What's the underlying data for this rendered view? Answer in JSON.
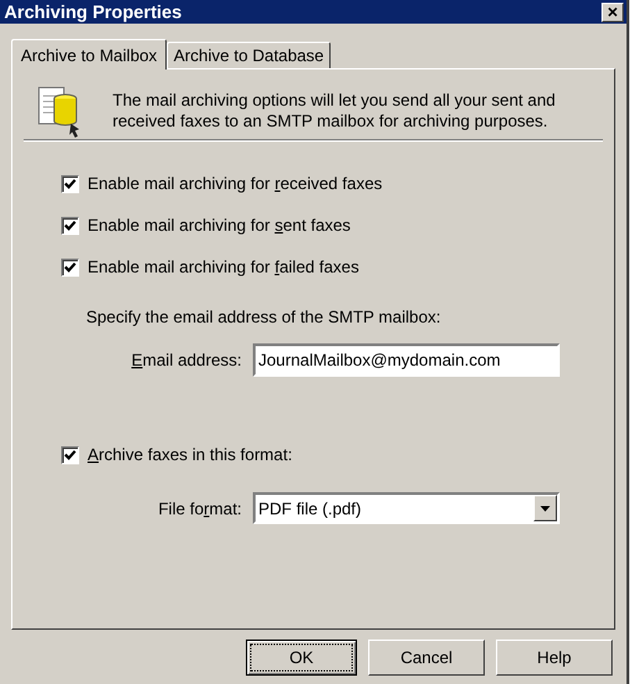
{
  "window": {
    "title": "Archiving Properties",
    "close": "×"
  },
  "tabs": [
    {
      "label": "Archive to Mailbox",
      "selected": true
    },
    {
      "label": "Archive to Database",
      "selected": false
    }
  ],
  "description": "The mail archiving options will let you send all your sent and received faxes to an SMTP mailbox for archiving purposes.",
  "options": [
    {
      "label_parts": [
        "Enable mail archiving for ",
        "r",
        "eceived faxes"
      ],
      "checked": true
    },
    {
      "label_parts": [
        "Enable mail archiving for ",
        "s",
        "ent faxes"
      ],
      "checked": true
    },
    {
      "label_parts": [
        "Enable mail archiving for ",
        "f",
        "ailed faxes"
      ],
      "checked": true
    }
  ],
  "mailbox_hint": "Specify the email address of the SMTP mailbox:",
  "email": {
    "label_parts": {
      "key": "E",
      "after": "mail address:"
    },
    "value": "JournalMailbox@mydomain.com"
  },
  "format_option": {
    "label_parts": {
      "key": "A",
      "after": "rchive faxes in this format:"
    },
    "checked": true
  },
  "file_format": {
    "label_parts": [
      "File fo",
      "r",
      "mat:"
    ],
    "value": "PDF file (.pdf)"
  },
  "buttons": [
    {
      "label": "OK",
      "default": true
    },
    {
      "label": "Cancel",
      "default": false
    },
    {
      "label": "Help",
      "default": false
    }
  ]
}
